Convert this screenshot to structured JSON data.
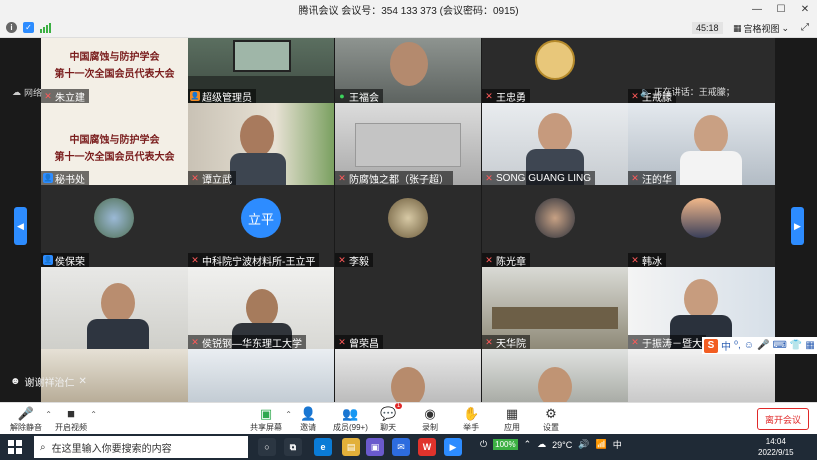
{
  "window": {
    "title": "腾讯会议 会议号：354 133 373  (会议密码：0915)",
    "timer": "45:18",
    "view_label": "宫格视图",
    "network_label": "网络",
    "speaking_label": "正在讲话：王戒朦；"
  },
  "tiles": [
    {
      "id": "r1c1",
      "name": "朱立建",
      "icon": "mic-off",
      "banner": [
        "中国腐蚀与防护学会",
        "第十一次全国会员代表大会"
      ]
    },
    {
      "id": "r1c2",
      "name": "超级管理员",
      "icon": "host"
    },
    {
      "id": "r1c3",
      "name": "王福会",
      "icon": "mic-on"
    },
    {
      "id": "r1c4",
      "name": "王忠勇",
      "icon": "mic-off"
    },
    {
      "id": "r1c5",
      "name": "王戒朦",
      "icon": "mic-off"
    },
    {
      "id": "r2c1",
      "name": "秘书处",
      "icon": "user",
      "banner": [
        "中国腐蚀与防护学会",
        "第十一次全国会员代表大会"
      ]
    },
    {
      "id": "r2c2",
      "name": "谭立武",
      "icon": "mic-off"
    },
    {
      "id": "r2c3",
      "name": "防腐蚀之都（张子超）",
      "icon": "mic-off"
    },
    {
      "id": "r2c4",
      "name": "SONG GUANG LING",
      "icon": "mic-off"
    },
    {
      "id": "r2c5",
      "name": "汪的华",
      "icon": "mic-off"
    },
    {
      "id": "r3c1",
      "name": "侯保荣",
      "icon": "user"
    },
    {
      "id": "r3c2",
      "name": "中科院宁波材料所-王立平",
      "icon": "mic-off",
      "initials": "立平"
    },
    {
      "id": "r3c3",
      "name": "李毅",
      "icon": "mic-off"
    },
    {
      "id": "r3c4",
      "name": "陈光章",
      "icon": "mic-off"
    },
    {
      "id": "r3c5",
      "name": "韩冰",
      "icon": "mic-off"
    },
    {
      "id": "r4c1",
      "name": "",
      "icon": "none"
    },
    {
      "id": "r4c2",
      "name": "侯锐钢—华东理工大学",
      "icon": "mic-off"
    },
    {
      "id": "r4c3",
      "name": "曾荣昌",
      "icon": "mic-off"
    },
    {
      "id": "r4c4",
      "name": "天华院",
      "icon": "mic-off"
    },
    {
      "id": "r4c5",
      "name": "于振涛－暨大",
      "icon": "mic-off"
    }
  ],
  "overlay": {
    "reaction_tip": "谢谢祥治仁",
    "ime_label": "中"
  },
  "toolbar": {
    "mute_label": "解除静音",
    "video_label": "开启视频",
    "share_label": "共享屏幕",
    "invite_label": "邀请",
    "members_label": "成员(99+)",
    "chat_label": "聊天",
    "record_label": "录制",
    "hand_label": "举手",
    "apps_label": "应用",
    "settings_label": "设置",
    "leave_label": "离开会议",
    "chat_badge": "1"
  },
  "taskbar": {
    "search_placeholder": "在这里输入你要搜索的内容",
    "battery": "100%",
    "weather": "29°C",
    "time": "14:04",
    "date": "2022/9/15"
  },
  "colors": {
    "accent": "#2d8cff",
    "danger": "#e02828",
    "banner_red": "#7a1d1d"
  }
}
